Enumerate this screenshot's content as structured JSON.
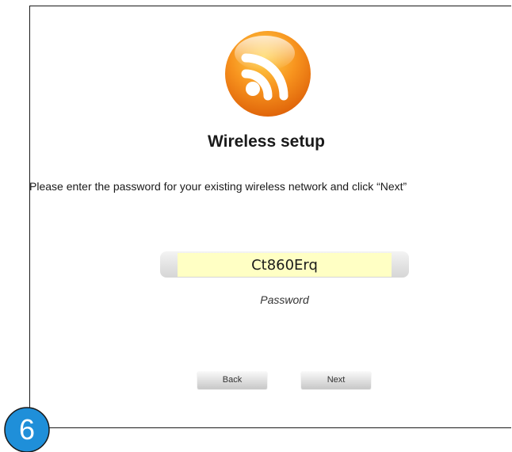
{
  "heading": {
    "title": "Wireless setup"
  },
  "instruction": "Please enter the password for your existing wireless network and click “Next”",
  "password": {
    "value": "Ct860Erq",
    "caption": "Password",
    "highlight_color": "#ffffc4"
  },
  "buttons": {
    "back_label": "Back",
    "next_label": "Next"
  },
  "step": {
    "number": "6",
    "color": "#1f8fd9"
  },
  "icons": {
    "logo": "wifi-rss-icon"
  },
  "colors": {
    "logo_orange": "#f7931e"
  }
}
